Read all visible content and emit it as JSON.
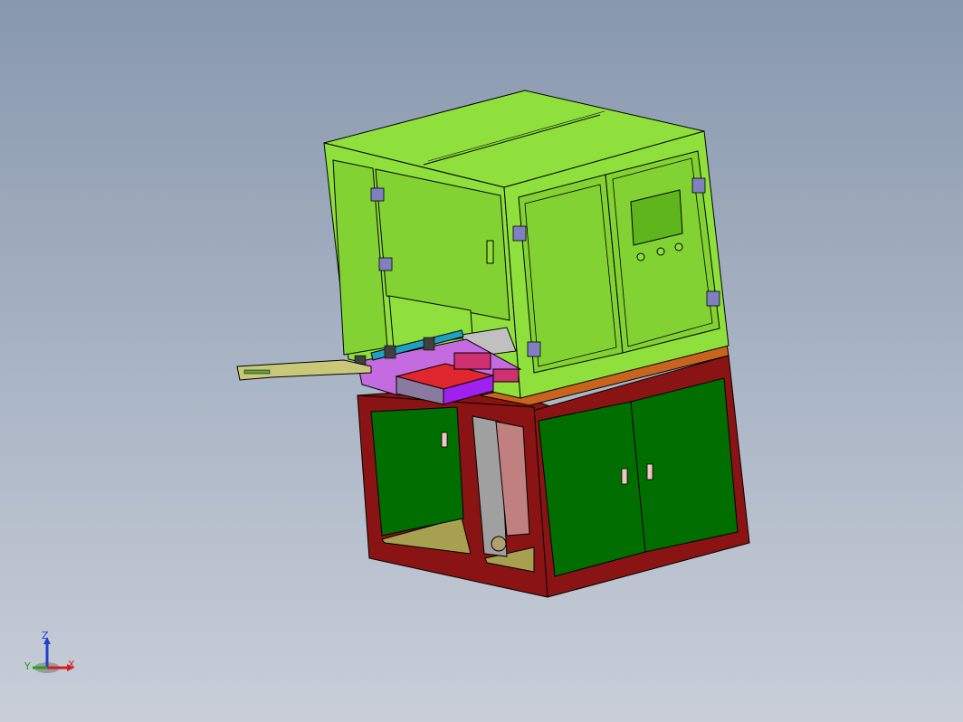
{
  "viewport": {
    "background_top": "#8898ad",
    "background_bottom": "#c9ced8"
  },
  "model": {
    "colors": {
      "upper_cabinet": "#8fe03c",
      "upper_cabinet_dark": "#5fb51c",
      "lower_frame": "#8a1414",
      "lower_doors": "#006e00",
      "base_strip": "#c8641e",
      "work_plate": "#c46be0",
      "block_red": "#e0262e",
      "block_purple": "#a020f0",
      "arm": "#c8c878",
      "panel_pink": "#c08080",
      "panel_gray": "#a0a0a0",
      "hinge": "#8080c0"
    }
  },
  "triad": {
    "z_label": "Z",
    "x_label": "X",
    "y_label": "Y",
    "z_color": "#2040d0",
    "x_color": "#d02020",
    "y_color": "#20a020"
  }
}
